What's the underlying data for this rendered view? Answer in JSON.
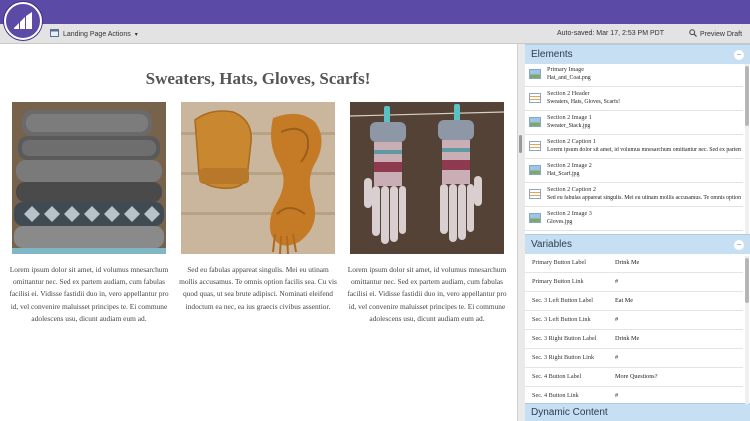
{
  "toolbar": {
    "actions_label": "Landing Page Actions",
    "autosave": "Auto-saved: Mar 17, 2:53 PM PDT",
    "preview_label": "Preview Draft"
  },
  "page": {
    "title": "Sweaters, Hats, Gloves, Scarfs!",
    "columns": [
      {
        "text": "Lorem ipsum dolor sit amet, id volumus mnesarchum omittantur nec. Sed ex partem audiam, cum fabulas facilisi ei. Vidisse fastidii duo in, vero appellantur pro id, vel convenire maluisset principes te. Ei commune adolescens usu, dicunt audiam eum ad."
      },
      {
        "text": "Sed eu fabulas appareat singulis. Mei eu utinam mollis accusamus. Te omnis option facilis sea. Cu vis quod quas, ut sea brute adipisci. Nominati eleifend indoctum ea nec, ea ius graecis civibus assentior."
      },
      {
        "text": "Lorem ipsum dolor sit amet, id volumus mnesarchum omittantur nec. Sed ex partem audiam, cum fabulas facilisi ei. Vidisse fastidii duo in, vero appellantur pro id, vel convenire maluisset principes te. Ei commune adolescens usu, dicunt audiam eum ad."
      }
    ]
  },
  "side": {
    "elements_header": "Elements",
    "variables_header": "Variables",
    "dynamic_header": "Dynamic Content",
    "elements": [
      {
        "name": "Primary Image",
        "value": "Hat_and_Coat.png",
        "kind": "img"
      },
      {
        "name": "Section 2 Header",
        "value": "Sweaters, Hats, Gloves, Scarfs!",
        "kind": "txt"
      },
      {
        "name": "Section 2 Image 1",
        "value": "Sweater_Stack.jpg",
        "kind": "img"
      },
      {
        "name": "Section 2 Caption 1",
        "value": "Lorem ipsum dolor sit amet, id volumus mnesarchum omittantur nec. Sed ex partem",
        "kind": "txt"
      },
      {
        "name": "Section 2 Image 2",
        "value": "Hat_Scarf.jpg",
        "kind": "img"
      },
      {
        "name": "Section 2 Caption 2",
        "value": "Sed eu fabulas appareat singulis. Mei eu utinam mollis accusamus. Te omnis option",
        "kind": "txt"
      },
      {
        "name": "Section 2 Image 3",
        "value": "Gloves.jpg",
        "kind": "img"
      }
    ],
    "variables": [
      {
        "name": "Primary Button Label",
        "value": "Drink Me"
      },
      {
        "name": "Primary Button Link",
        "value": "#"
      },
      {
        "name": "Sec. 3 Left Button Label",
        "value": "Eat Me"
      },
      {
        "name": "Sec. 3 Left Button Link",
        "value": "#"
      },
      {
        "name": "Sec. 3 Right Button Label",
        "value": "Drink Me"
      },
      {
        "name": "Sec. 3 Right Button Link",
        "value": "#"
      },
      {
        "name": "Sec. 4 Button Label",
        "value": "More Questions?"
      },
      {
        "name": "Sec. 4 Button Link",
        "value": "#"
      }
    ]
  },
  "icons": {
    "logo": "marketo-logo-icon",
    "actions": "page-icon",
    "preview": "search-icon",
    "collapse": "minus-circle-icon"
  },
  "colors": {
    "brand": "#5b4aa6",
    "panel_header": "#c7dff2"
  }
}
